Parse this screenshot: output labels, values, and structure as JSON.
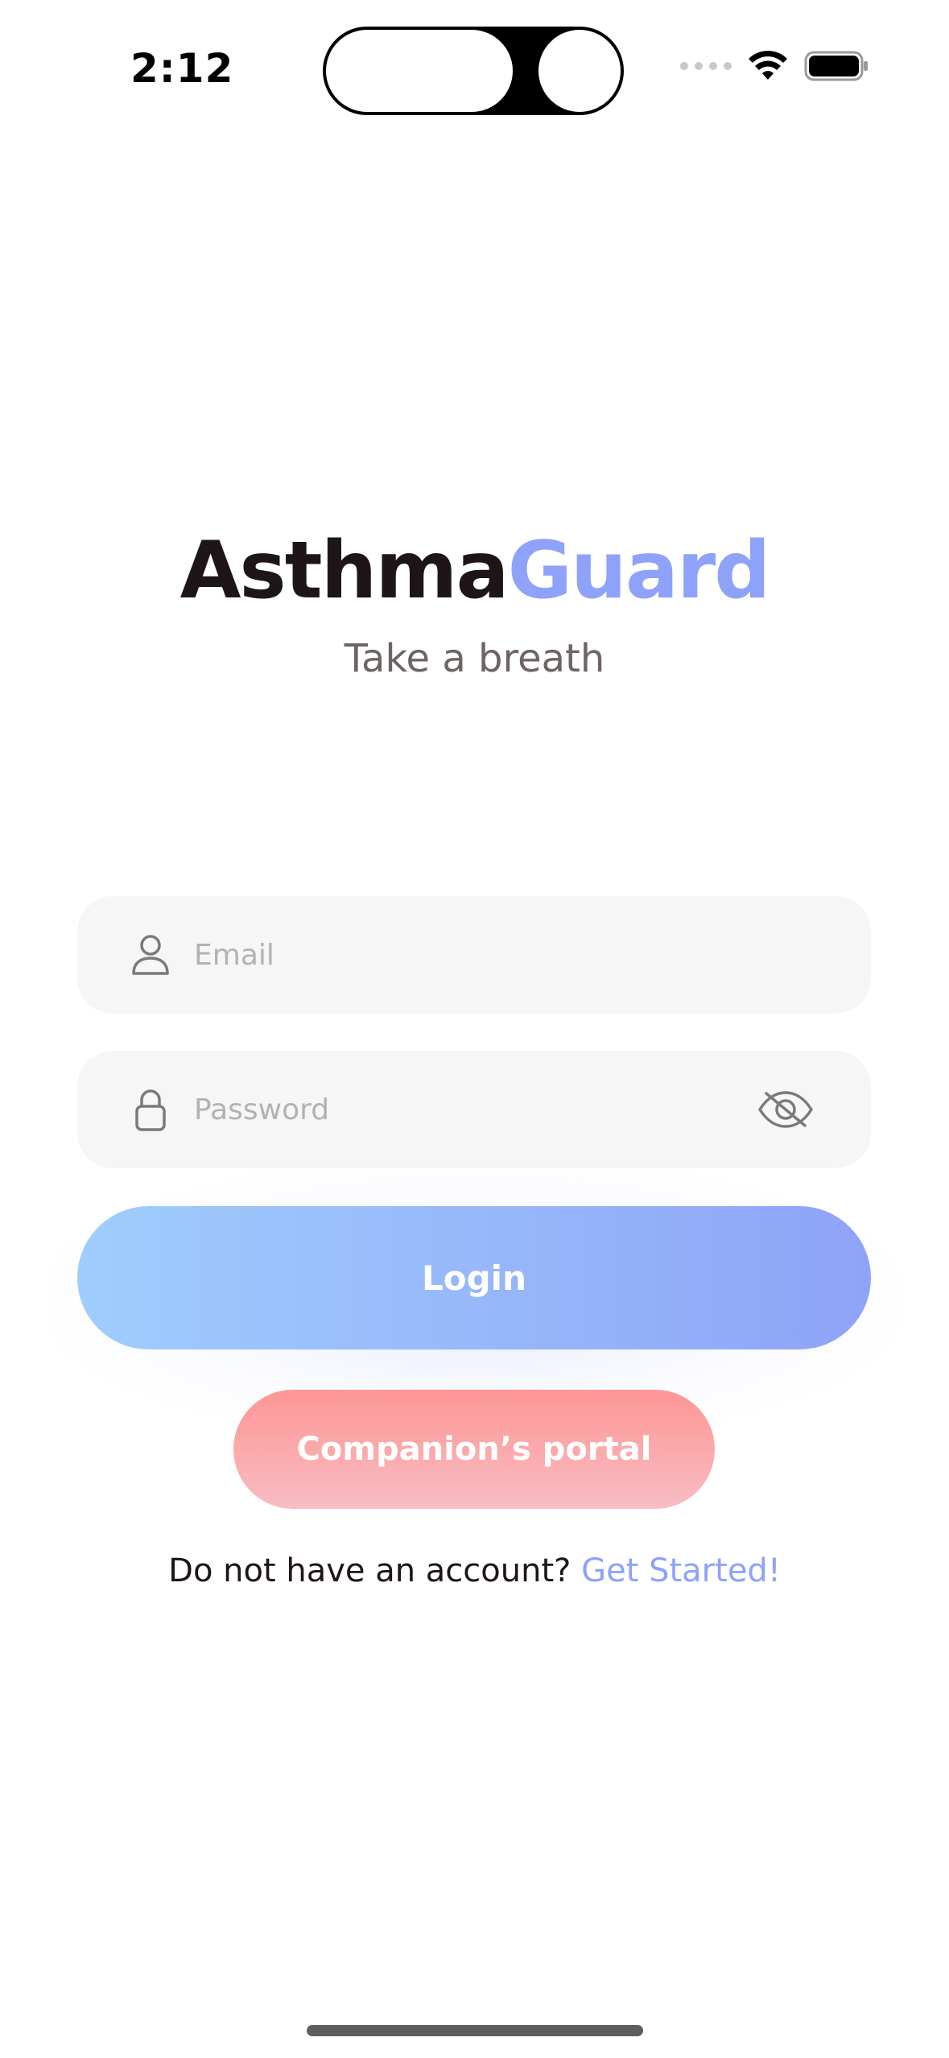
{
  "status_bar": {
    "time": "2:12"
  },
  "app": {
    "title_part1": "Asthma",
    "title_part2": "Guard",
    "tagline": "Take a breath"
  },
  "form": {
    "email_placeholder": "Email",
    "password_placeholder": "Password"
  },
  "buttons": {
    "login": "Login",
    "companion": "Companion’s portal"
  },
  "signup": {
    "prompt": "Do not have an account?",
    "link": "Get Started!"
  },
  "colors": {
    "brand_accent": "#8fa2f9",
    "login_gradient_start": "#9fcdfc",
    "login_gradient_end": "#8fa3f8",
    "companion_gradient_start": "#fd9694",
    "companion_gradient_end": "#f8bdc4",
    "title_dark": "#1e1616"
  },
  "icons": {
    "email_field": "user-icon",
    "password_field": "lock-icon",
    "password_toggle": "eye-off-icon",
    "status_wifi": "wifi-icon",
    "status_battery": "battery-icon"
  }
}
